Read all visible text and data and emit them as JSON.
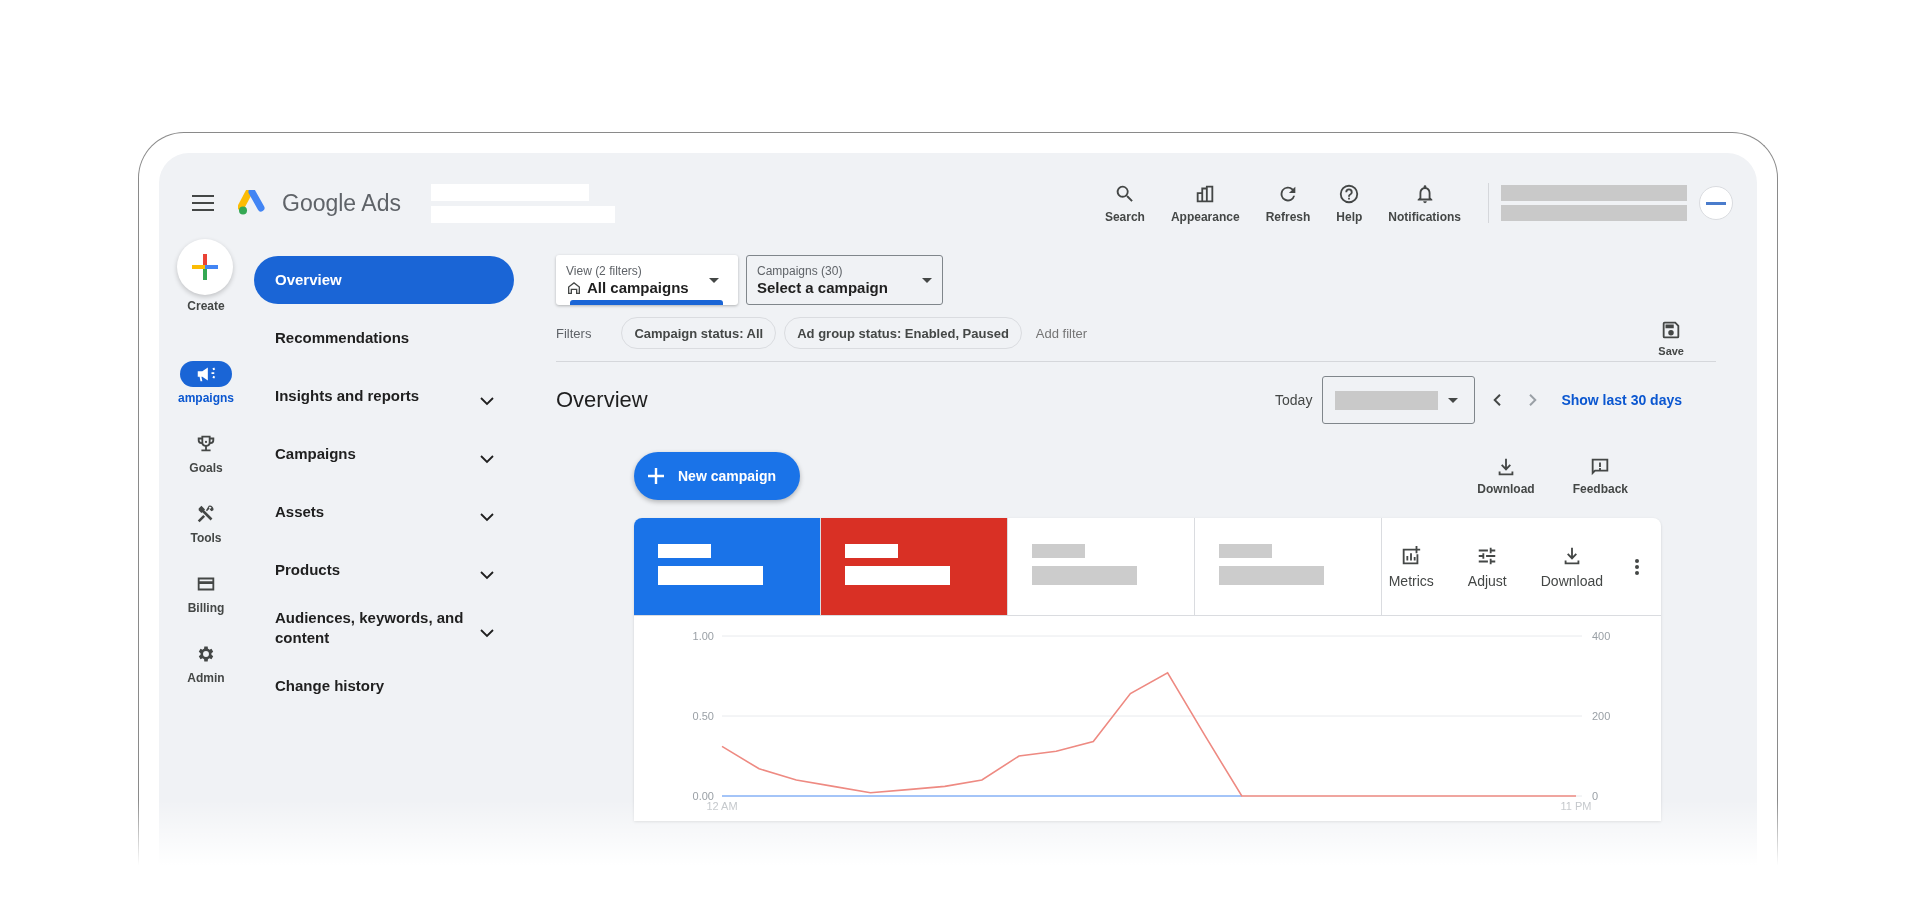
{
  "header": {
    "product": "Google Ads",
    "actions": [
      {
        "label": "Search"
      },
      {
        "label": "Appearance"
      },
      {
        "label": "Refresh"
      },
      {
        "label": "Help"
      },
      {
        "label": "Notifications"
      }
    ]
  },
  "create_button": "Create",
  "rail": [
    {
      "label": "ampaigns",
      "kind": "item",
      "selected": true
    },
    {
      "label": "Goals",
      "kind": "item",
      "selected": false
    },
    {
      "label": "Tools",
      "kind": "item",
      "selected": false
    },
    {
      "label": "Billing",
      "kind": "item",
      "selected": false
    },
    {
      "label": "Admin",
      "kind": "item",
      "selected": false
    }
  ],
  "nav": [
    {
      "label": "Overview",
      "kind": "link",
      "selected": true
    },
    {
      "label": "Recommendations",
      "kind": "link",
      "selected": false
    },
    {
      "label": "Insights and reports",
      "kind": "group",
      "selected": false
    },
    {
      "label": "Campaigns",
      "kind": "group",
      "selected": false
    },
    {
      "label": "Assets",
      "kind": "group",
      "selected": false
    },
    {
      "label": "Products",
      "kind": "group",
      "selected": false
    },
    {
      "label": "Audiences, keywords, and content",
      "kind": "group",
      "selected": false
    },
    {
      "label": "Change history",
      "kind": "link",
      "selected": false
    }
  ],
  "view_picker": {
    "caption": "View (2 filters)",
    "value": "All campaigns"
  },
  "campaign_picker": {
    "caption": "Campaigns (30)",
    "value": "Select a campaign"
  },
  "filters": {
    "label": "Filters",
    "chips": [
      "Campaign status: All",
      "Ad group status: Enabled, Paused"
    ],
    "add": "Add filter",
    "save": "Save"
  },
  "overview": {
    "title": "Overview",
    "date_label": "Today",
    "range_link": "Show last 30 days"
  },
  "new_campaign": "New campaign",
  "page_actions": [
    "Download",
    "Feedback"
  ],
  "metric_tiles": [
    {
      "color": "#1a73e8",
      "selected": true
    },
    {
      "color": "#d93025",
      "selected": true
    },
    {
      "color": "#ffffff",
      "selected": false
    },
    {
      "color": "#ffffff",
      "selected": false
    }
  ],
  "chart_actions": [
    "Metrics",
    "Adjust",
    "Download"
  ],
  "chart": {
    "chart_data": {
      "type": "line",
      "categories": [
        "12 AM",
        null,
        null,
        null,
        null,
        null,
        null,
        null,
        null,
        null,
        null,
        null,
        null,
        null,
        null,
        null,
        null,
        null,
        null,
        null,
        null,
        null,
        null,
        "11 PM"
      ],
      "ylim": [
        0,
        1
      ],
      "yticks": [
        {
          "value": 0,
          "label": "0.00"
        },
        {
          "value": 0.5,
          "label": "0.50"
        },
        {
          "value": 1,
          "label": "1.00"
        }
      ],
      "y2lim": [
        0,
        400
      ],
      "y2ticks": [
        {
          "value": 0,
          "label": "0"
        },
        {
          "value": 200,
          "label": "200"
        },
        {
          "value": 400,
          "label": "400"
        }
      ],
      "series": [
        {
          "color": "#8ab4f8",
          "values": [
            0,
            0,
            0,
            0,
            0,
            0,
            0,
            0,
            0,
            0,
            0,
            0,
            0,
            0,
            0,
            null,
            null,
            null,
            null,
            null,
            null,
            null,
            null,
            null
          ]
        },
        {
          "color": "#ee8a82",
          "values": [
            0.31,
            0.17,
            0.1,
            0.06,
            0.02,
            0.04,
            0.06,
            0.1,
            0.25,
            0.28,
            0.34,
            0.64,
            0.77,
            0.38,
            0,
            0,
            0,
            0,
            0,
            0,
            0,
            0,
            0,
            0
          ]
        }
      ]
    }
  }
}
